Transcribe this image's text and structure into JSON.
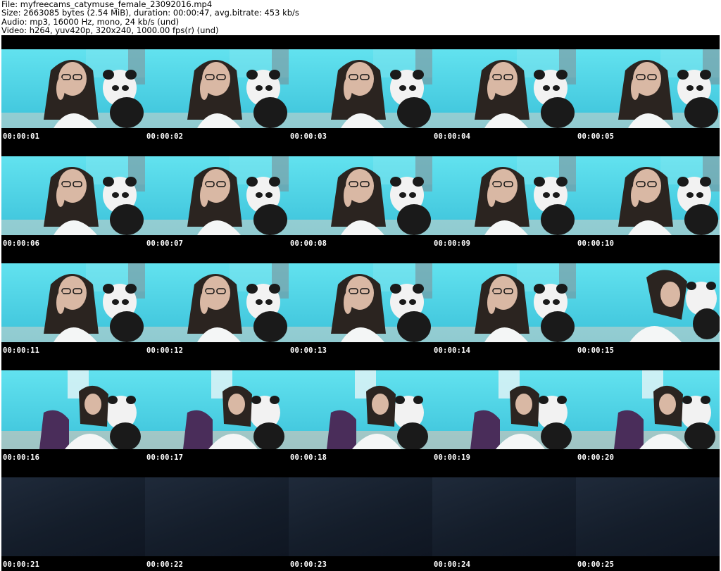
{
  "header": {
    "file_line": "File: myfreecams_catymuse_female_23092016.mp4",
    "size_line": "Size: 2663085 bytes (2.54 MiB), duration: 00:00:47, avg.bitrate: 453 kb/s",
    "audio_line": "Audio: mp3, 16000 Hz, mono, 24 kb/s (und)",
    "video_line": "Video: h264, yuv420p, 320x240, 1000.00 fps(r) (und)"
  },
  "thumbnails": [
    {
      "time": "00:00:01",
      "scene": "close"
    },
    {
      "time": "00:00:02",
      "scene": "close"
    },
    {
      "time": "00:00:03",
      "scene": "close"
    },
    {
      "time": "00:00:04",
      "scene": "close"
    },
    {
      "time": "00:00:05",
      "scene": "close"
    },
    {
      "time": "00:00:06",
      "scene": "close"
    },
    {
      "time": "00:00:07",
      "scene": "close"
    },
    {
      "time": "00:00:08",
      "scene": "close"
    },
    {
      "time": "00:00:09",
      "scene": "close"
    },
    {
      "time": "00:00:10",
      "scene": "close"
    },
    {
      "time": "00:00:11",
      "scene": "close"
    },
    {
      "time": "00:00:12",
      "scene": "close"
    },
    {
      "time": "00:00:13",
      "scene": "close"
    },
    {
      "time": "00:00:14",
      "scene": "close"
    },
    {
      "time": "00:00:15",
      "scene": "leaning"
    },
    {
      "time": "00:00:16",
      "scene": "wide"
    },
    {
      "time": "00:00:17",
      "scene": "wide"
    },
    {
      "time": "00:00:18",
      "scene": "wide"
    },
    {
      "time": "00:00:19",
      "scene": "wide"
    },
    {
      "time": "00:00:20",
      "scene": "wide"
    },
    {
      "time": "00:00:21",
      "scene": "dark"
    },
    {
      "time": "00:00:22",
      "scene": "dark"
    },
    {
      "time": "00:00:23",
      "scene": "dark"
    },
    {
      "time": "00:00:24",
      "scene": "dark"
    },
    {
      "time": "00:00:25",
      "scene": "dark"
    }
  ]
}
